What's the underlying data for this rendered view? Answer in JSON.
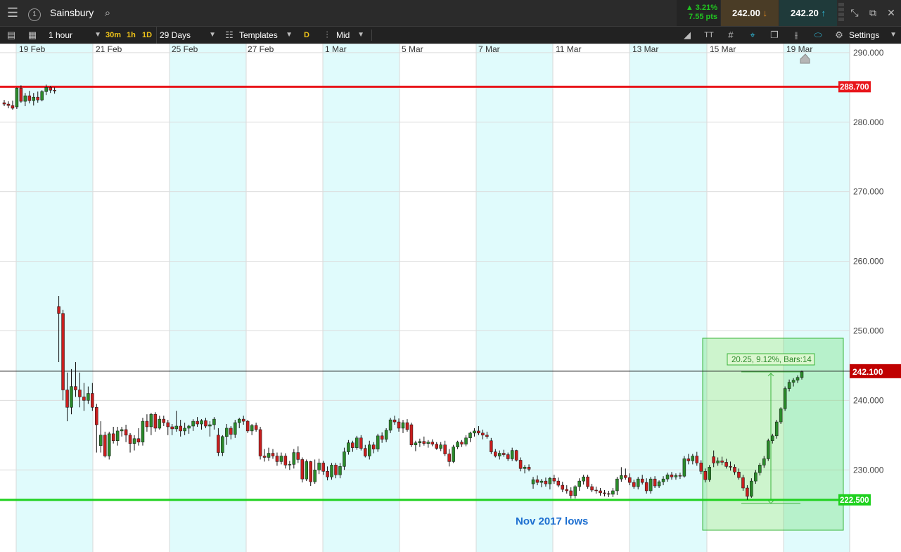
{
  "header": {
    "instrument_number": "1",
    "instrument_name": "Sainsbury",
    "change_pct": "▲ 3.21%",
    "change_pts": "7.55 pts",
    "sell_price": "242.00",
    "buy_price": "242.20",
    "colors": {
      "change": "#21c321",
      "sell_bg": "#4a3c26",
      "buy_bg": "#1f3a3a",
      "sell_arrow": "#e08a1e",
      "buy_arrow": "#2fb8d6"
    }
  },
  "toolbar": {
    "interval": "1 hour",
    "quick_30m": "30m",
    "quick_1h": "1h",
    "quick_1d": "1D",
    "range": "29 Days",
    "templates": "Templates",
    "d_button": "D",
    "price_type": "Mid",
    "settings": "Settings",
    "icons": [
      "list-icon",
      "layout-icon",
      "draw-line-icon",
      "text-icon",
      "grid-icon",
      "crosshair-icon",
      "clone-icon",
      "candle-type-icon",
      "tag-icon",
      "gear-icon"
    ]
  },
  "chart_data": {
    "type": "candlestick",
    "instrument": "Sainsbury",
    "x_labels": [
      "19 Feb",
      "21 Feb",
      "25 Feb",
      "27 Feb",
      "1 Mar",
      "5 Mar",
      "7 Mar",
      "11 Mar",
      "13 Mar",
      "15 Mar",
      "19 Mar"
    ],
    "y_ticks": [
      "290.000",
      "280.000",
      "270.000",
      "260.000",
      "250.000",
      "240.000",
      "230.000"
    ],
    "y_tick_values": [
      290,
      280,
      270,
      260,
      250,
      240,
      230
    ],
    "ylim": [
      218.2,
      291.3
    ],
    "levels": [
      {
        "name": "resistance",
        "value": 285.1,
        "label": "288.700",
        "color": "#e8161b"
      },
      {
        "name": "support",
        "value": 225.7,
        "label": "222.500",
        "color": "#1fd11f"
      },
      {
        "name": "current",
        "value": 244.2,
        "label": "242.100",
        "color": "#c00000"
      }
    ],
    "annotation_text": "Nov 2017 lows",
    "measure_label": "20.25, 9.12%, Bars:14",
    "measure_range": {
      "from": 225.7,
      "to": 243.9
    },
    "candle_colors": {
      "up": "#2a8a2a",
      "down": "#c81e1e"
    },
    "candles": [
      [
        282.8,
        283.2,
        282.3,
        282.6
      ],
      [
        282.6,
        283.0,
        282.0,
        282.4
      ],
      [
        282.4,
        283.1,
        281.8,
        282.0
      ],
      [
        282.2,
        285.0,
        281.9,
        284.9
      ],
      [
        284.9,
        285.3,
        282.8,
        283.0
      ],
      [
        283.0,
        284.2,
        282.3,
        283.8
      ],
      [
        283.8,
        284.5,
        282.7,
        283.1
      ],
      [
        283.1,
        284.2,
        282.4,
        283.6
      ],
      [
        283.6,
        284.4,
        282.8,
        283.2
      ],
      [
        283.2,
        284.6,
        283.0,
        284.4
      ],
      [
        284.4,
        285.4,
        283.9,
        285.0
      ],
      [
        285.0,
        285.2,
        284.2,
        284.6
      ],
      [
        284.6,
        285.0,
        284.1,
        284.5
      ],
      [
        253.5,
        255.0,
        245.5,
        252.5
      ],
      [
        252.5,
        253.0,
        240.0,
        241.5
      ],
      [
        241.5,
        244.0,
        237.0,
        239.0
      ],
      [
        239.0,
        244.5,
        238.0,
        242.0
      ],
      [
        242.0,
        245.5,
        240.5,
        241.5
      ],
      [
        241.5,
        244.0,
        239.0,
        240.5
      ],
      [
        240.5,
        242.5,
        238.5,
        240.0
      ],
      [
        240.0,
        242.0,
        239.5,
        241.0
      ],
      [
        241.0,
        242.5,
        238.5,
        239.0
      ],
      [
        239.0,
        239.5,
        232.5,
        236.5
      ],
      [
        233.5,
        237.0,
        232.5,
        235.0
      ],
      [
        235.0,
        235.5,
        231.8,
        232.0
      ],
      [
        232.0,
        235.5,
        231.5,
        235.2
      ],
      [
        235.2,
        236.2,
        233.8,
        234.2
      ],
      [
        234.2,
        236.2,
        233.5,
        235.6
      ],
      [
        235.6,
        236.2,
        234.8,
        235.8
      ],
      [
        235.8,
        236.5,
        234.0,
        235.0
      ],
      [
        235.0,
        235.3,
        232.5,
        233.8
      ],
      [
        233.8,
        235.0,
        232.8,
        234.5
      ],
      [
        234.5,
        236.0,
        233.5,
        234.0
      ],
      [
        234.0,
        237.5,
        233.5,
        237.0
      ],
      [
        237.0,
        238.0,
        235.5,
        236.2
      ],
      [
        236.2,
        238.2,
        235.0,
        238.0
      ],
      [
        238.0,
        238.3,
        235.5,
        236.0
      ],
      [
        236.0,
        237.8,
        235.8,
        237.3
      ],
      [
        237.3,
        237.8,
        236.3,
        236.8
      ],
      [
        236.8,
        237.2,
        235.0,
        236.2
      ],
      [
        236.2,
        236.6,
        235.0,
        235.9
      ],
      [
        235.9,
        238.5,
        235.5,
        236.3
      ],
      [
        236.3,
        237.2,
        234.8,
        235.6
      ],
      [
        235.6,
        236.8,
        235.0,
        236.0
      ],
      [
        236.0,
        236.5,
        235.2,
        236.3
      ],
      [
        236.3,
        237.3,
        235.6,
        237.0
      ],
      [
        237.0,
        237.6,
        236.2,
        236.6
      ],
      [
        236.6,
        237.3,
        235.8,
        237.1
      ],
      [
        237.1,
        237.5,
        236.0,
        236.3
      ],
      [
        236.3,
        237.0,
        234.8,
        236.5
      ],
      [
        236.5,
        237.6,
        235.8,
        237.3
      ],
      [
        235.0,
        236.0,
        232.0,
        232.5
      ],
      [
        232.5,
        235.0,
        232.0,
        234.8
      ],
      [
        234.8,
        236.6,
        233.6,
        236.0
      ],
      [
        236.0,
        236.3,
        234.4,
        235.1
      ],
      [
        235.1,
        237.2,
        234.6,
        236.8
      ],
      [
        236.8,
        237.5,
        236.0,
        237.3
      ],
      [
        237.3,
        237.8,
        236.5,
        237.0
      ],
      [
        237.0,
        237.2,
        235.3,
        235.6
      ],
      [
        235.6,
        236.6,
        235.0,
        236.4
      ],
      [
        236.4,
        236.8,
        235.5,
        235.8
      ],
      [
        235.8,
        236.2,
        231.5,
        232.0
      ],
      [
        232.0,
        233.0,
        231.2,
        231.8
      ],
      [
        231.8,
        233.2,
        231.3,
        232.4
      ],
      [
        232.4,
        233.0,
        231.6,
        232.0
      ],
      [
        232.0,
        232.5,
        230.6,
        231.2
      ],
      [
        231.2,
        232.5,
        230.8,
        232.0
      ],
      [
        232.0,
        232.4,
        230.2,
        230.7
      ],
      [
        230.7,
        231.3,
        230.0,
        230.8
      ],
      [
        230.8,
        233.0,
        230.2,
        232.5
      ],
      [
        232.5,
        233.4,
        231.0,
        231.5
      ],
      [
        231.5,
        231.8,
        228.2,
        228.7
      ],
      [
        228.7,
        231.5,
        228.4,
        231.2
      ],
      [
        231.2,
        231.3,
        227.7,
        228.3
      ],
      [
        228.3,
        231.5,
        228.0,
        230.0
      ],
      [
        230.0,
        231.6,
        229.4,
        231.0
      ],
      [
        231.0,
        231.3,
        229.3,
        229.8
      ],
      [
        229.8,
        230.5,
        228.5,
        229.0
      ],
      [
        229.0,
        231.0,
        228.6,
        230.7
      ],
      [
        230.7,
        231.0,
        228.8,
        229.3
      ],
      [
        229.3,
        231.0,
        228.8,
        230.5
      ],
      [
        230.5,
        233.2,
        230.0,
        232.6
      ],
      [
        232.6,
        234.3,
        232.2,
        233.9
      ],
      [
        233.9,
        234.2,
        232.6,
        233.2
      ],
      [
        233.2,
        234.9,
        232.9,
        234.6
      ],
      [
        234.6,
        235.0,
        232.8,
        233.1
      ],
      [
        233.1,
        233.6,
        231.8,
        232.0
      ],
      [
        232.0,
        234.2,
        231.5,
        233.6
      ],
      [
        233.6,
        234.0,
        232.4,
        233.0
      ],
      [
        233.0,
        235.2,
        232.6,
        234.9
      ],
      [
        234.9,
        235.4,
        233.9,
        234.4
      ],
      [
        234.4,
        236.0,
        234.0,
        235.7
      ],
      [
        235.7,
        237.5,
        235.3,
        237.2
      ],
      [
        237.2,
        237.8,
        236.5,
        236.9
      ],
      [
        236.9,
        237.4,
        235.5,
        236.0
      ],
      [
        236.0,
        237.2,
        235.3,
        236.8
      ],
      [
        236.8,
        237.3,
        235.5,
        235.8
      ],
      [
        236.5,
        236.8,
        233.3,
        233.6
      ],
      [
        233.6,
        234.2,
        232.7,
        233.9
      ],
      [
        233.9,
        234.5,
        233.3,
        234.1
      ],
      [
        234.1,
        234.8,
        233.5,
        233.8
      ],
      [
        233.8,
        234.3,
        233.2,
        234.0
      ],
      [
        234.0,
        234.4,
        233.4,
        233.7
      ],
      [
        233.7,
        234.0,
        232.9,
        233.1
      ],
      [
        233.1,
        234.0,
        232.7,
        233.6
      ],
      [
        233.6,
        234.2,
        232.0,
        232.3
      ],
      [
        232.3,
        233.0,
        230.5,
        231.2
      ],
      [
        231.2,
        233.6,
        231.0,
        233.3
      ],
      [
        233.3,
        234.2,
        233.0,
        234.0
      ],
      [
        234.0,
        234.3,
        233.3,
        233.7
      ],
      [
        233.7,
        235.0,
        233.4,
        234.6
      ],
      [
        234.6,
        235.5,
        234.0,
        235.3
      ],
      [
        235.3,
        236.0,
        234.8,
        235.6
      ],
      [
        235.6,
        236.3,
        235.0,
        235.3
      ],
      [
        235.3,
        235.8,
        234.4,
        235.0
      ],
      [
        235.0,
        235.5,
        234.5,
        234.8
      ],
      [
        234.2,
        234.6,
        232.3,
        232.6
      ],
      [
        232.6,
        233.0,
        231.8,
        232.0
      ],
      [
        232.0,
        232.8,
        231.5,
        232.4
      ],
      [
        232.4,
        232.9,
        231.9,
        232.2
      ],
      [
        232.2,
        232.5,
        231.3,
        231.6
      ],
      [
        231.6,
        233.2,
        231.3,
        232.8
      ],
      [
        232.8,
        232.9,
        231.2,
        231.4
      ],
      [
        231.4,
        231.8,
        229.8,
        230.2
      ],
      [
        230.2,
        230.7,
        229.5,
        230.4
      ],
      [
        230.4,
        230.8,
        229.8,
        230.1
      ],
      [
        228.0,
        229.0,
        227.3,
        228.6
      ],
      [
        228.6,
        229.2,
        227.8,
        228.2
      ],
      [
        228.2,
        228.7,
        227.5,
        228.4
      ],
      [
        228.4,
        228.9,
        227.6,
        228.0
      ],
      [
        228.0,
        229.0,
        227.2,
        228.8
      ],
      [
        228.8,
        229.3,
        228.0,
        228.4
      ],
      [
        228.4,
        228.9,
        227.5,
        227.8
      ],
      [
        227.8,
        228.3,
        226.8,
        227.2
      ],
      [
        227.2,
        227.8,
        226.6,
        227.0
      ],
      [
        227.0,
        227.5,
        225.9,
        226.3
      ],
      [
        226.3,
        227.8,
        225.9,
        227.6
      ],
      [
        227.6,
        228.8,
        227.0,
        228.4
      ],
      [
        228.4,
        229.3,
        227.9,
        229.0
      ],
      [
        229.0,
        229.3,
        227.3,
        227.6
      ],
      [
        227.6,
        228.0,
        226.8,
        227.1
      ],
      [
        227.1,
        227.6,
        226.6,
        227.0
      ],
      [
        227.0,
        227.4,
        226.3,
        226.7
      ],
      [
        226.7,
        227.1,
        226.2,
        226.6
      ],
      [
        226.6,
        227.0,
        226.1,
        226.5
      ],
      [
        226.5,
        227.4,
        226.1,
        227.0
      ],
      [
        227.0,
        229.0,
        226.4,
        228.7
      ],
      [
        228.7,
        230.4,
        228.3,
        229.2
      ],
      [
        229.2,
        230.2,
        228.6,
        228.9
      ],
      [
        228.9,
        229.5,
        227.8,
        228.2
      ],
      [
        228.2,
        228.6,
        227.3,
        227.6
      ],
      [
        227.6,
        229.0,
        227.2,
        228.7
      ],
      [
        228.7,
        229.3,
        227.9,
        228.2
      ],
      [
        228.2,
        228.8,
        226.6,
        227.0
      ],
      [
        227.0,
        229.0,
        226.6,
        228.7
      ],
      [
        228.7,
        229.1,
        227.4,
        227.7
      ],
      [
        227.7,
        228.5,
        227.4,
        228.3
      ],
      [
        228.3,
        229.1,
        227.8,
        228.7
      ],
      [
        228.7,
        229.6,
        228.3,
        229.3
      ],
      [
        229.3,
        229.7,
        228.6,
        229.0
      ],
      [
        229.0,
        229.5,
        228.6,
        229.2
      ],
      [
        229.2,
        229.6,
        228.7,
        229.1
      ],
      [
        229.1,
        232.0,
        228.9,
        231.6
      ],
      [
        231.6,
        232.3,
        230.8,
        231.3
      ],
      [
        231.3,
        232.3,
        230.8,
        232.0
      ],
      [
        232.0,
        232.6,
        230.6,
        231.0
      ],
      [
        231.0,
        231.4,
        229.4,
        229.8
      ],
      [
        229.8,
        230.2,
        228.2,
        228.6
      ],
      [
        228.6,
        230.7,
        228.3,
        230.4
      ],
      [
        231.9,
        232.8,
        230.4,
        231.0
      ],
      [
        231.0,
        231.8,
        230.6,
        231.3
      ],
      [
        231.3,
        231.9,
        230.7,
        231.1
      ],
      [
        231.1,
        231.6,
        230.2,
        230.5
      ],
      [
        230.5,
        231.2,
        229.9,
        230.4
      ],
      [
        230.4,
        230.8,
        229.3,
        229.7
      ],
      [
        229.7,
        230.2,
        228.6,
        228.9
      ],
      [
        228.9,
        229.3,
        227.0,
        227.4
      ],
      [
        227.4,
        227.8,
        225.7,
        226.2
      ],
      [
        226.2,
        228.8,
        226.0,
        228.4
      ],
      [
        228.4,
        230.0,
        228.0,
        229.6
      ],
      [
        229.6,
        231.0,
        229.2,
        230.7
      ],
      [
        230.7,
        232.0,
        230.3,
        231.6
      ],
      [
        231.6,
        234.5,
        231.3,
        234.2
      ],
      [
        234.2,
        235.2,
        233.8,
        234.9
      ],
      [
        234.9,
        237.2,
        234.5,
        236.9
      ],
      [
        236.9,
        239.0,
        236.6,
        238.8
      ],
      [
        238.8,
        242.0,
        238.5,
        241.7
      ],
      [
        241.7,
        243.0,
        241.3,
        242.6
      ],
      [
        242.6,
        243.2,
        242.0,
        242.9
      ],
      [
        242.9,
        243.6,
        242.5,
        243.3
      ],
      [
        243.3,
        244.3,
        243.0,
        244.1
      ]
    ]
  }
}
